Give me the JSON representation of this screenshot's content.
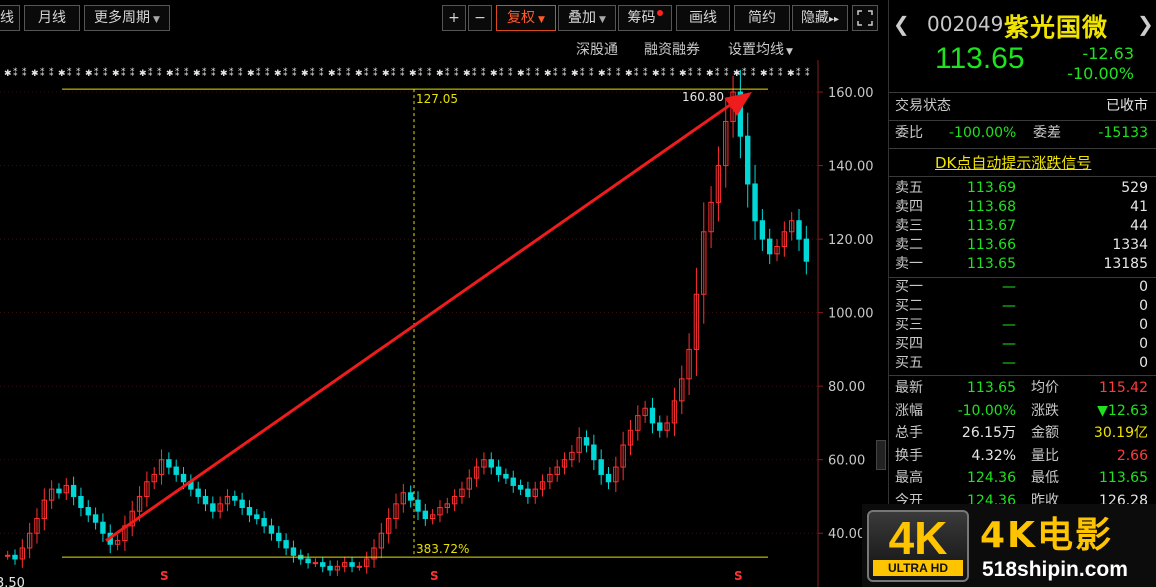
{
  "toolbar": {
    "period_partial": "线",
    "monthly": "月线",
    "more_periods": "更多周期",
    "zoom_in": "+",
    "zoom_out": "−",
    "restore_rights": "复权",
    "overlay": "叠加",
    "chips": "筹码",
    "draw_line": "画线",
    "simple": "简约",
    "hide": "隐藏",
    "expand": "▸▸"
  },
  "subtoolbar": {
    "shenzhen_connect": "深股通",
    "margin_trading": "融资融券",
    "set_ma": "设置均线"
  },
  "chart_data": {
    "type": "candlestick",
    "y_ticks": [
      "160.00",
      "140.00",
      "120.00",
      "100.00",
      "80.00",
      "60.00",
      "40.00"
    ],
    "ylim": [
      30,
      166
    ],
    "high_label": "160.80",
    "ruler_value": "127.05",
    "rise_percent": "383.72%",
    "low_label_partial": "3.50",
    "support_line": 33.5,
    "resistance_line": 160.8,
    "trend_arrow": {
      "from": 38,
      "to": 160
    },
    "closes": [
      34,
      33,
      36,
      40,
      44,
      49,
      52,
      51,
      53,
      50,
      47,
      45,
      43,
      40,
      37,
      38,
      42,
      46,
      50,
      54,
      56,
      60,
      58,
      56,
      54,
      52,
      50,
      48,
      46,
      48,
      50,
      49,
      47,
      45,
      44,
      42,
      40,
      38,
      36,
      34,
      33,
      32,
      32,
      31,
      30,
      31,
      32,
      31,
      31,
      33,
      36,
      40,
      44,
      48,
      51,
      49,
      46,
      44,
      45,
      47,
      48,
      50,
      52,
      55,
      58,
      60,
      58,
      56,
      55,
      53,
      52,
      50,
      52,
      54,
      56,
      58,
      60,
      62,
      66,
      64,
      60,
      56,
      54,
      58,
      64,
      68,
      72,
      74,
      70,
      68,
      70,
      76,
      82,
      90,
      105,
      122,
      130,
      140,
      152,
      160,
      148,
      135,
      125,
      120,
      116,
      118,
      122,
      125,
      120,
      114
    ]
  },
  "markers": {
    "s_label": "S"
  },
  "stock": {
    "code": "002049",
    "name": "紫光国微",
    "price": "113.65",
    "change": "-12.63",
    "change_pct": "-10.00%"
  },
  "status": {
    "label": "交易状态",
    "value": "已收市"
  },
  "bid_ratio": {
    "label": "委比",
    "value": "-100.00%",
    "diff_label": "委差",
    "diff_value": "-15133"
  },
  "dk_signal": "DK点自动提示涨跌信号",
  "asks": [
    {
      "label": "卖五",
      "price": "113.69",
      "volume": "529"
    },
    {
      "label": "卖四",
      "price": "113.68",
      "volume": "41"
    },
    {
      "label": "卖三",
      "price": "113.67",
      "volume": "44"
    },
    {
      "label": "卖二",
      "price": "113.66",
      "volume": "1334"
    },
    {
      "label": "卖一",
      "price": "113.65",
      "volume": "13185"
    }
  ],
  "bids": [
    {
      "label": "买一",
      "price": "—",
      "volume": "0"
    },
    {
      "label": "买二",
      "price": "—",
      "volume": "0"
    },
    {
      "label": "买三",
      "price": "—",
      "volume": "0"
    },
    {
      "label": "买四",
      "price": "—",
      "volume": "0"
    },
    {
      "label": "买五",
      "price": "—",
      "volume": "0"
    }
  ],
  "stats": [
    {
      "l1": "最新",
      "v1": "113.65",
      "l2": "均价",
      "v2": "115.42",
      "c1": "green",
      "c2": "red"
    },
    {
      "l1": "涨幅",
      "v1": "-10.00%",
      "l2": "涨跌",
      "v2": "▼12.63",
      "c1": "green",
      "c2": "green"
    },
    {
      "l1": "总手",
      "v1": "26.15万",
      "l2": "金额",
      "v2": "30.19亿",
      "c1": "white",
      "c2": "yellow"
    },
    {
      "l1": "换手",
      "v1": "4.32%",
      "l2": "量比",
      "v2": "2.66",
      "c1": "white",
      "c2": "red"
    },
    {
      "l1": "最高",
      "v1": "124.36",
      "l2": "最低",
      "v2": "113.65",
      "c1": "green",
      "c2": "green"
    },
    {
      "l1": "今开",
      "v1": "124.36",
      "l2": "昨收",
      "v2": "126.28",
      "c1": "green",
      "c2": "white"
    }
  ],
  "watermark": {
    "badge": "4K",
    "badge_sub": "ULTRA HD",
    "title": "4K电影",
    "url": "518shipin.com"
  },
  "colors": {
    "up": "#ff3030",
    "down": "#00d8d8",
    "accent": "#ff5a2a",
    "guide": "#e8e000",
    "arrow": "#ee1c1c"
  }
}
